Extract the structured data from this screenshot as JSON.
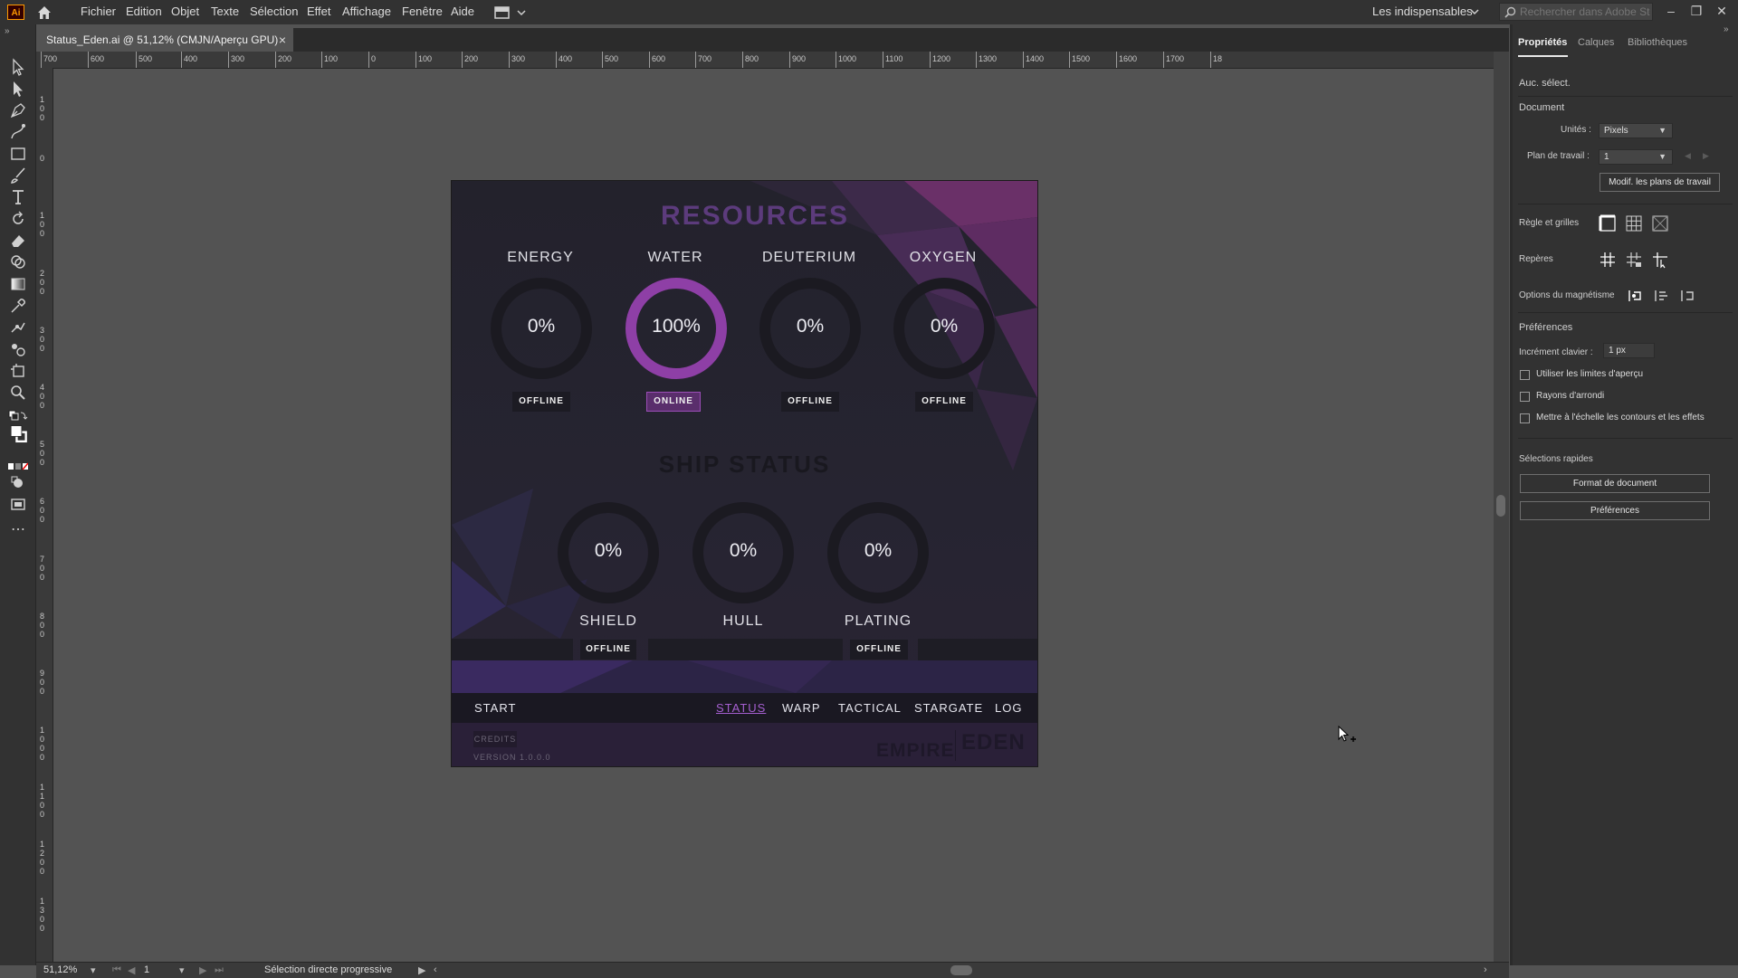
{
  "app": {
    "logo": "Ai",
    "menus": [
      "Fichier",
      "Edition",
      "Objet",
      "Texte",
      "Sélection",
      "Effet",
      "Affichage",
      "Fenêtre",
      "Aide"
    ],
    "workspace": "Les indispensables",
    "stock_search_placeholder": "Rechercher dans Adobe Stock",
    "window_controls": [
      "minimize",
      "restore",
      "close"
    ]
  },
  "document_tab": {
    "title": "Status_Eden.ai @ 51,12% (CMJN/Aperçu GPU)",
    "close": "×"
  },
  "ruler_h_ticks": [
    "700",
    "600",
    "500",
    "400",
    "300",
    "200",
    "100",
    "0",
    "100",
    "200",
    "300",
    "400",
    "500",
    "600",
    "700",
    "800",
    "900",
    "1000",
    "1100",
    "1200",
    "1300",
    "1400",
    "1500",
    "1600",
    "1700",
    "18"
  ],
  "ruler_v_ticks": [
    "100",
    "0",
    "100",
    "200",
    "300",
    "400",
    "500",
    "600",
    "700",
    "800",
    "900",
    "1000",
    "1100",
    "1200",
    "1300"
  ],
  "artboard": {
    "resources_title": "RESOURCES",
    "ship_status_title": "SHIP STATUS",
    "resources": [
      {
        "label": "ENERGY",
        "value": "0%",
        "fraction": 0,
        "status": "OFFLINE",
        "online": false
      },
      {
        "label": "WATER",
        "value": "100%",
        "fraction": 1,
        "status": "ONLINE",
        "online": true
      },
      {
        "label": "DEUTERIUM",
        "value": "0%",
        "fraction": 0,
        "status": "OFFLINE",
        "online": false
      },
      {
        "label": "OXYGEN",
        "value": "0%",
        "fraction": 0,
        "status": "OFFLINE",
        "online": false
      }
    ],
    "ship": [
      {
        "label": "SHIELD",
        "value": "0%",
        "fraction": 0,
        "status": "OFFLINE"
      },
      {
        "label": "HULL",
        "value": "0%",
        "fraction": 0,
        "status": ""
      },
      {
        "label": "PLATING",
        "value": "0%",
        "fraction": 0,
        "status": "OFFLINE"
      }
    ],
    "nav": {
      "start": "START",
      "status": "STATUS",
      "warp": "WARP",
      "tactical": "TACTICAL",
      "stargate": "STARGATE",
      "log": "LOG"
    },
    "credits": "CREDITS",
    "version": "VERSION 1.0.0.0",
    "logo_left": "EMPIRE",
    "logo_right": "EDEN",
    "colors": {
      "accent": "#a55fd0",
      "ring_track": "#1b1a21",
      "ring_fill": "#8e3fa6"
    }
  },
  "panel": {
    "tabs": [
      "Propriétés",
      "Calques",
      "Bibliothèques"
    ],
    "no_selection": "Auc. sélect.",
    "document_header": "Document",
    "units_label": "Unités :",
    "units_value": "Pixels",
    "artboard_label": "Plan de travail :",
    "artboard_value": "1",
    "edit_artboards": "Modif. les plans de travail",
    "rulers_grids": "Règle et grilles",
    "guides": "Repères",
    "snap_options": "Options du magnétisme",
    "preferences_header": "Préférences",
    "keyboard_increment_label": "Incrément clavier :",
    "keyboard_increment_value": "1 px",
    "checkboxes": [
      "Utiliser les limites d'aperçu",
      "Rayons d'arrondi",
      "Mettre à l'échelle les contours et les effets"
    ],
    "quick_actions": "Sélections rapides",
    "document_setup": "Format de document",
    "preferences_button": "Préférences"
  },
  "statusbar": {
    "zoom": "51,12%",
    "artboard_nav": "1",
    "tool_status": "Sélection directe progressive"
  }
}
